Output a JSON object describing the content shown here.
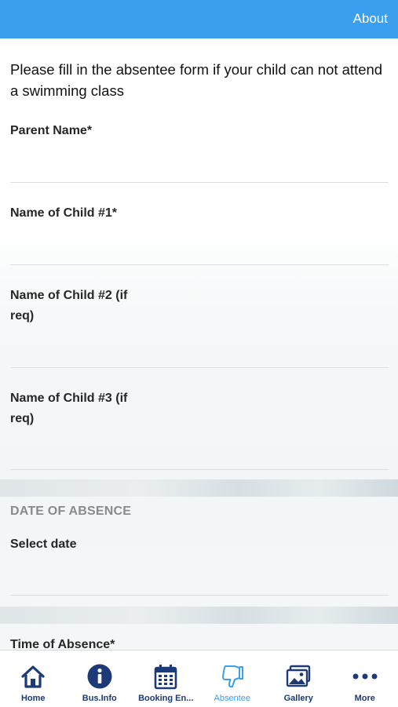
{
  "header": {
    "about_label": "About"
  },
  "form": {
    "intro": "Please fill in the absentee form if your child can not attend a swimming class",
    "fields": [
      {
        "label": "Parent Name*",
        "value": ""
      },
      {
        "label": "Name of Child #1*",
        "value": ""
      },
      {
        "label": "Name of Child #2 (if\nreq)",
        "value": ""
      },
      {
        "label": "Name of Child #3 (if\nreq)",
        "value": ""
      }
    ],
    "section_date": "DATE OF ABSENCE",
    "select_date_label": "Select date",
    "select_date_value": "",
    "time_label": "Time of Absence*"
  },
  "tabs": [
    {
      "label": "Home",
      "icon": "home-icon"
    },
    {
      "label": "Bus.Info",
      "icon": "info-icon"
    },
    {
      "label": "Booking En...",
      "icon": "calendar-icon"
    },
    {
      "label": "Absentee",
      "icon": "thumbs-down-icon",
      "active": true
    },
    {
      "label": "Gallery",
      "icon": "gallery-icon"
    },
    {
      "label": "More",
      "icon": "more-icon"
    }
  ],
  "colors": {
    "accent": "#3b9ff0",
    "tab_icon": "#1c3a78"
  }
}
